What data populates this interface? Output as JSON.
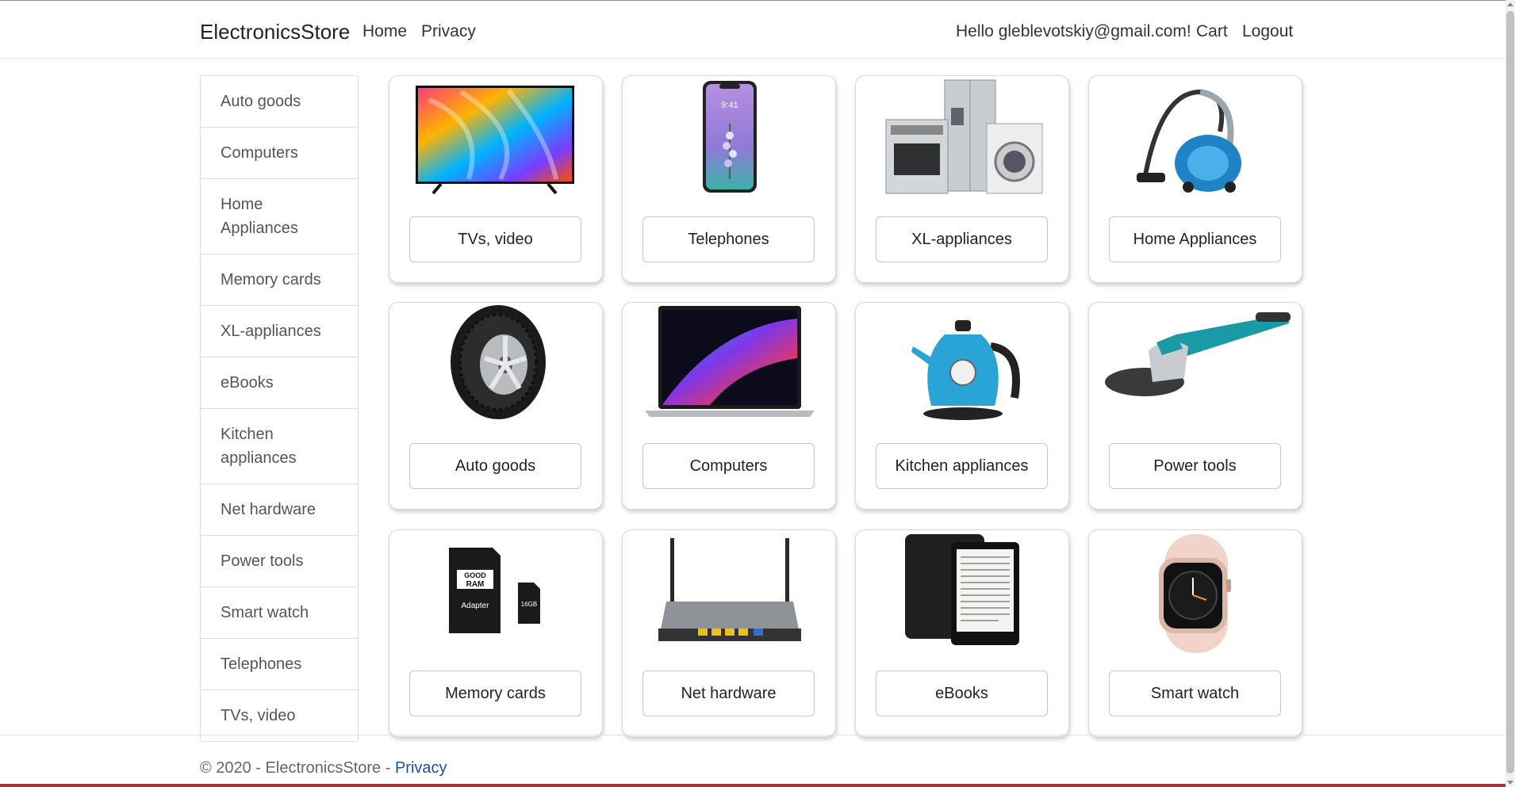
{
  "nav": {
    "brand": "ElectronicsStore",
    "home": "Home",
    "privacy": "Privacy",
    "greeting": "Hello gleblevotskiy@gmail.com!",
    "cart": "Cart",
    "logout": "Logout"
  },
  "sidebar": {
    "items": [
      {
        "label": "Auto goods"
      },
      {
        "label": "Computers"
      },
      {
        "label": "Home Appliances"
      },
      {
        "label": "Memory cards"
      },
      {
        "label": "XL-appliances"
      },
      {
        "label": "eBooks"
      },
      {
        "label": "Kitchen appliances"
      },
      {
        "label": "Net hardware"
      },
      {
        "label": "Power tools"
      },
      {
        "label": "Smart watch"
      },
      {
        "label": "Telephones"
      },
      {
        "label": "TVs, video"
      }
    ]
  },
  "cards": [
    {
      "label": "TVs, video",
      "icon": "tv-icon"
    },
    {
      "label": "Telephones",
      "icon": "smartphone-icon"
    },
    {
      "label": "XL-appliances",
      "icon": "large-appliances-icon"
    },
    {
      "label": "Home Appliances",
      "icon": "vacuum-cleaner-icon"
    },
    {
      "label": "Auto goods",
      "icon": "tire-icon"
    },
    {
      "label": "Computers",
      "icon": "laptop-icon"
    },
    {
      "label": "Kitchen appliances",
      "icon": "kettle-icon"
    },
    {
      "label": "Power tools",
      "icon": "angle-grinder-icon"
    },
    {
      "label": "Memory cards",
      "icon": "memory-card-icon"
    },
    {
      "label": "Net hardware",
      "icon": "router-icon"
    },
    {
      "label": "eBooks",
      "icon": "ebook-reader-icon"
    },
    {
      "label": "Smart watch",
      "icon": "smartwatch-icon"
    }
  ],
  "footer": {
    "copyright": "© 2020 - ElectronicsStore - ",
    "privacy": "Privacy"
  },
  "colors": {
    "link": "#1f4f9a",
    "bottom_bar": "#c0282f",
    "card_border": "#d8d8d8"
  }
}
